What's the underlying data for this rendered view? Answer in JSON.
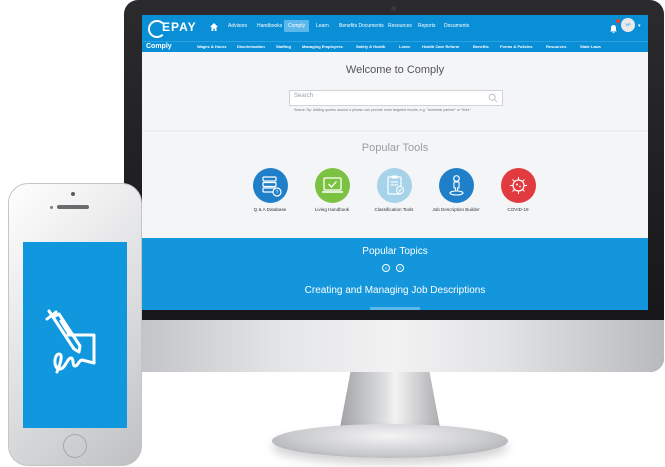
{
  "topnav": {
    "logo_text": "EPAY",
    "items": [
      "Advisors",
      "Handbooks",
      "Comply",
      "Learn",
      "Benefits Documents",
      "Resources",
      "Reports",
      "Documents"
    ],
    "active_index": 2,
    "avatar_initials": "VP"
  },
  "subnav": {
    "brand": "Comply",
    "items": [
      "Wages & Hours",
      "Discrimination",
      "Staffing",
      "Managing Employees",
      "Safety & Health",
      "Leave",
      "Health Care Reform",
      "Benefits",
      "Forms & Policies",
      "Resources",
      "State Laws"
    ]
  },
  "main": {
    "welcome_title": "Welcome to Comply",
    "search_placeholder": "Search",
    "search_tip": "Search Tip: Adding quotes around a phrase can provide more targeted results, e.g. \"domestic partner\" or \"fmla\"",
    "popular_tools_title": "Popular Tools",
    "tools": [
      {
        "label": "Q & A Database",
        "color": "#1f7fc8",
        "icon": "database-question-icon"
      },
      {
        "label": "Living Handbook",
        "color": "#7cc242",
        "icon": "laptop-check-icon"
      },
      {
        "label": "Classification Tools",
        "color": "#a7d3ea",
        "icon": "clipboard-check-icon"
      },
      {
        "label": "Job Description Builder",
        "color": "#1f7fc8",
        "icon": "person-pin-icon"
      },
      {
        "label": "COVID-19",
        "color": "#e23b3f",
        "icon": "virus-icon"
      }
    ]
  },
  "topics": {
    "title": "Popular Topics",
    "prev_label": "‹",
    "next_label": "›",
    "current_topic": "Creating and Managing Job Descriptions"
  },
  "phone": {
    "screen_icon": "signature-pen-icon",
    "screen_color": "#1097dd"
  },
  "colors": {
    "brand_blue": "#0a8fd6",
    "band_blue": "#1496dc"
  }
}
